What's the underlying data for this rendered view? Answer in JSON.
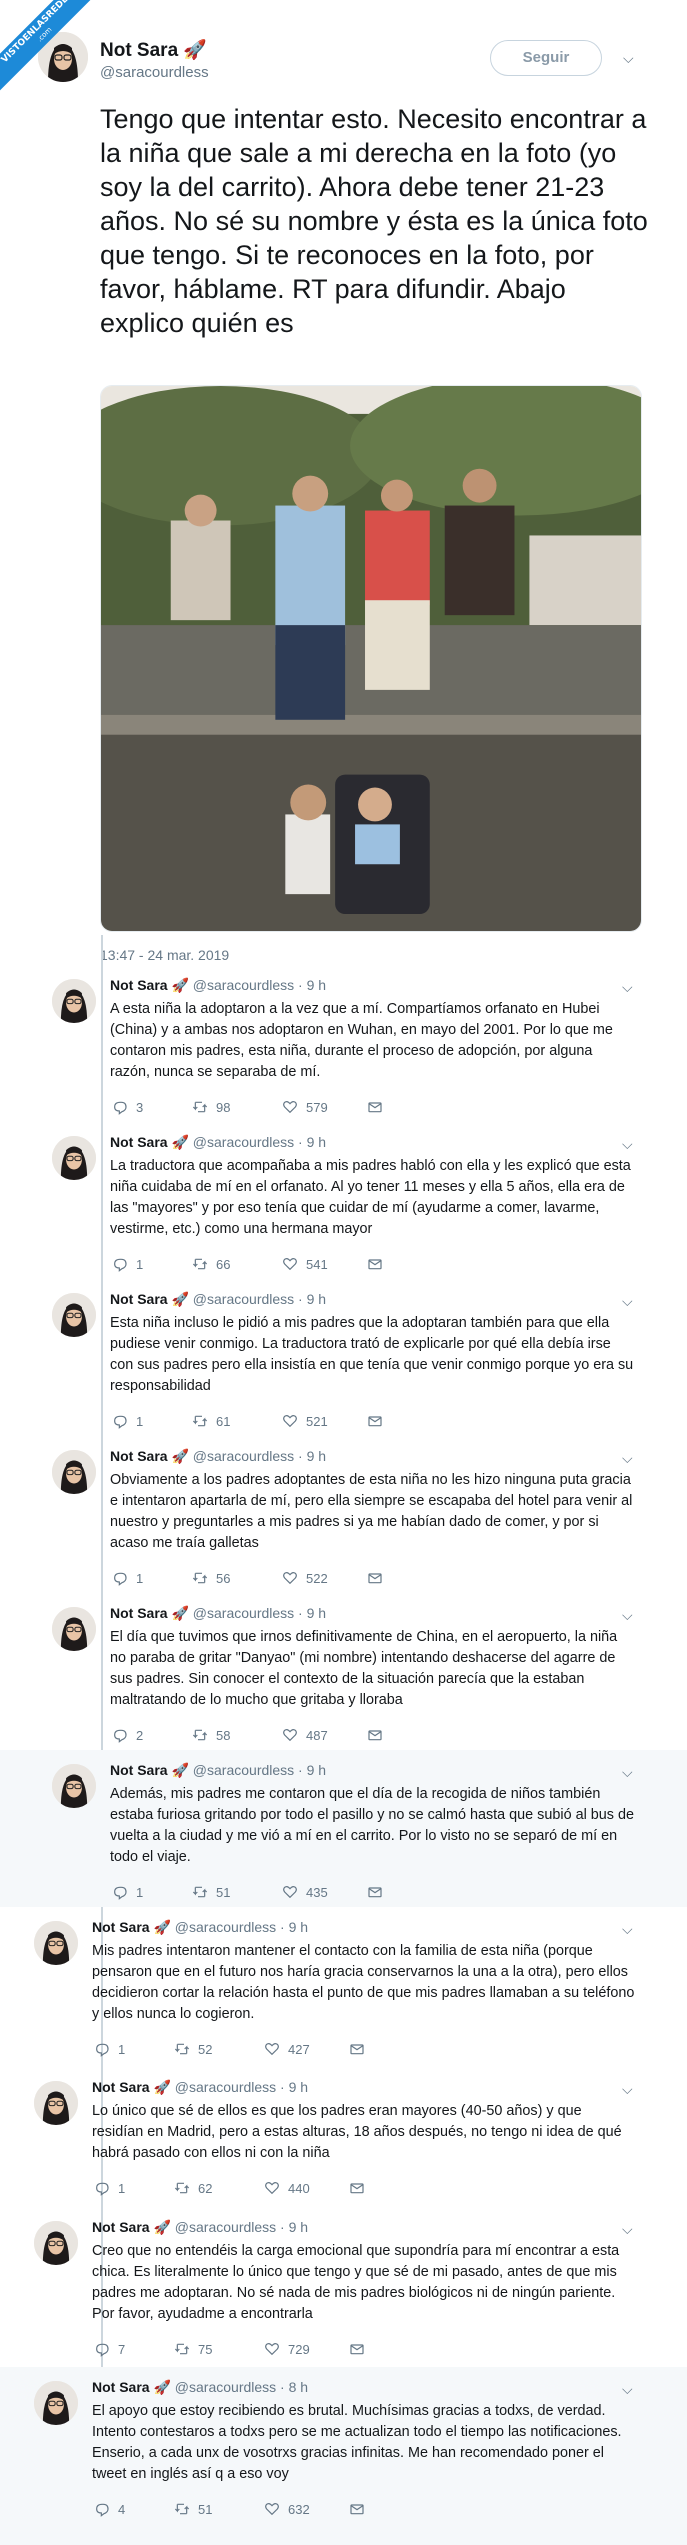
{
  "watermark": {
    "line1": "VISTOENLASREDES",
    "line2": ".com"
  },
  "main": {
    "name": "Not Sara",
    "emoji": "🚀",
    "handle": "@saracourdless",
    "follow_label": "Seguir",
    "text": "Tengo que intentar esto. Necesito encontrar a la niña que sale a mi derecha en la foto (yo soy la del carrito). Ahora debe tener 21-23 años. No sé su nombre y ésta es la única foto que tengo. Si te reconoces en la foto, por favor, háblame. RT para difundir. Abajo explico quién es",
    "timestamp": "13:47 - 24 mar. 2019"
  },
  "replies": [
    {
      "name": "Not Sara",
      "emoji": "🚀",
      "handle": "@saracourdless · 9 h",
      "text": "A esta niña la adoptaron a la vez que a mí. Compartíamos orfanato en Hubei (China) y a ambas nos adoptaron en Wuhan, en mayo del 2001. Por lo que me contaron mis padres, esta niña, durante el proceso de adopción, por alguna razón, nunca se separaba de mí.",
      "replies": "3",
      "retweets": "98",
      "likes": "579"
    },
    {
      "name": "Not Sara",
      "emoji": "🚀",
      "handle": "@saracourdless · 9 h",
      "text": "La traductora que acompañaba a mis padres habló con ella y les explicó que esta niña cuidaba de mí en el orfanato. Al yo tener 11 meses y ella 5 años, ella era de las \"mayores\" y por eso tenía que cuidar de mí (ayudarme a comer, lavarme, vestirme, etc.) como una hermana mayor",
      "replies": "1",
      "retweets": "66",
      "likes": "541"
    },
    {
      "name": "Not Sara",
      "emoji": "🚀",
      "handle": "@saracourdless · 9 h",
      "text": "Esta niña incluso le pidió a mis padres que la adoptaran también para que ella pudiese venir conmigo. La traductora trató de explicarle por qué ella debía irse con sus padres pero ella insistía en que tenía que venir conmigo porque yo era su responsabilidad",
      "replies": "1",
      "retweets": "61",
      "likes": "521"
    },
    {
      "name": "Not Sara",
      "emoji": "🚀",
      "handle": "@saracourdless · 9 h",
      "text": "Obviamente a los padres adoptantes de esta niña no les hizo ninguna puta gracia e intentaron apartarla de mí, pero ella siempre se escapaba del hotel para venir al nuestro y preguntarles a mis padres si ya me habían dado de comer, y por si acaso me traía galletas",
      "replies": "1",
      "retweets": "56",
      "likes": "522"
    },
    {
      "name": "Not Sara",
      "emoji": "🚀",
      "handle": "@saracourdless · 9 h",
      "text": "El día que tuvimos que irnos definitivamente de China, en el aeropuerto, la niña no paraba de gritar \"Danyao\" (mi nombre) intentando deshacerse del agarre de sus padres. Sin conocer el contexto de la situación parecía que la estaban maltratando de lo mucho que gritaba y lloraba",
      "replies": "2",
      "retweets": "58",
      "likes": "487"
    },
    {
      "name": "Not Sara",
      "emoji": "🚀",
      "handle": "@saracourdless · 9 h",
      "text": "Además, mis padres me contaron que el día de la recogida de niños también estaba furiosa gritando por todo el pasillo y no se calmó hasta que subió al bus de vuelta a la ciudad y me vió a mí en el carrito. Por lo visto no se separó de mí en todo el viaje.",
      "replies": "1",
      "retweets": "51",
      "likes": "435"
    },
    {
      "name": "Not Sara",
      "emoji": "🚀",
      "handle": "@saracourdless · 9 h",
      "text": "Mis padres intentaron mantener el contacto con la familia de esta niña (porque pensaron que en el futuro nos haría gracia conservarnos la una a la otra), pero ellos decidieron cortar la relación hasta el punto de que mis padres llamaban a su teléfono y ellos nunca lo cogieron.",
      "replies": "1",
      "retweets": "52",
      "likes": "427"
    },
    {
      "name": "Not Sara",
      "emoji": "🚀",
      "handle": "@saracourdless · 9 h",
      "text": "Lo único que sé de ellos es que los padres eran mayores (40-50 años) y que residían en Madrid, pero a estas alturas, 18 años después, no tengo ni idea de qué habrá pasado con ellos ni con la niña",
      "replies": "1",
      "retweets": "62",
      "likes": "440"
    },
    {
      "name": "Not Sara",
      "emoji": "🚀",
      "handle": "@saracourdless · 9 h",
      "text": "Creo que no entendéis la carga emocional que supondría para mí encontrar a esta chica. Es literalmente lo único que tengo y que sé de mi pasado, antes de que mis padres me adoptaran. No sé nada de mis padres biológicos ni de ningún pariente. Por favor, ayudadme a encontrarla",
      "replies": "7",
      "retweets": "75",
      "likes": "729"
    },
    {
      "name": "Not Sara",
      "emoji": "🚀",
      "handle": "@saracourdless · 8 h",
      "text": "El apoyo que estoy recibiendo es brutal. Muchísimas gracias a todxs, de verdad. Intento contestaros a todxs pero se me actualizan todo el tiempo las notificaciones. Enserio, a cada unx de vosotrxs gracias infinitas. Me han recomendado poner el tweet en inglés así q a eso voy",
      "replies": "4",
      "retweets": "51",
      "likes": "632"
    }
  ],
  "icons": {
    "reply": "reply-icon",
    "retweet": "retweet-icon",
    "like": "heart-icon",
    "dm": "mail-icon",
    "more": "chevron-down-icon"
  },
  "colors": {
    "muted": "#657786",
    "text": "#14171a",
    "highlight_bg": "#f5f8fa",
    "ribbon": "#1d8ad8"
  }
}
